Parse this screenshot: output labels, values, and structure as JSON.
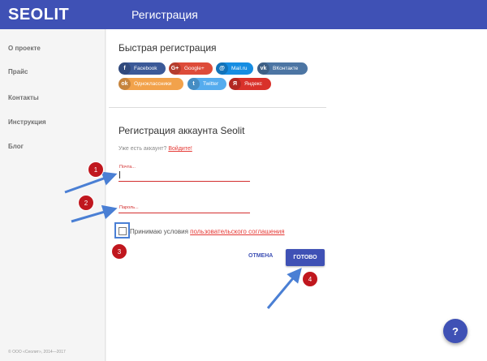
{
  "header": {
    "logo": "SEOLIT",
    "title": "Регистрация"
  },
  "sidebar": {
    "items": [
      {
        "label": "О проекте"
      },
      {
        "label": "Прайс"
      },
      {
        "label": "Контакты"
      },
      {
        "label": "Инструкция"
      },
      {
        "label": "Блог"
      }
    ],
    "footer": "© ООО «Сеолит», 2014—2017"
  },
  "quick": {
    "title": "Быстрая регистрация",
    "providers": [
      {
        "label": "Facebook",
        "icon": "f",
        "color": "#3b5998"
      },
      {
        "label": "Google+",
        "icon": "G+",
        "color": "#dd4b39"
      },
      {
        "label": "Mail.ru",
        "icon": "@",
        "color": "#168de2"
      },
      {
        "label": "ВКонтакте",
        "icon": "vk",
        "color": "#4c75a3"
      },
      {
        "label": "Одноклассники",
        "icon": "ok",
        "color": "#f2a24b"
      },
      {
        "label": "Twitter",
        "icon": "t",
        "color": "#55acee"
      },
      {
        "label": "Яндекс",
        "icon": "Я",
        "color": "#d9312a"
      }
    ]
  },
  "form": {
    "title": "Регистрация аккаунта Seolit",
    "has_account": "Уже есть аккаунт?",
    "login_link": "Войдите!",
    "email_label": "Почта...",
    "password_label": "Пароль...",
    "agree_text": "Принимаю условия",
    "agree_link": "пользовательского соглашения",
    "cancel": "ОТМЕНА",
    "submit": "ГОТОВО"
  },
  "annotations": {
    "steps": [
      "1",
      "2",
      "3",
      "4"
    ]
  },
  "help": {
    "icon": "?"
  }
}
